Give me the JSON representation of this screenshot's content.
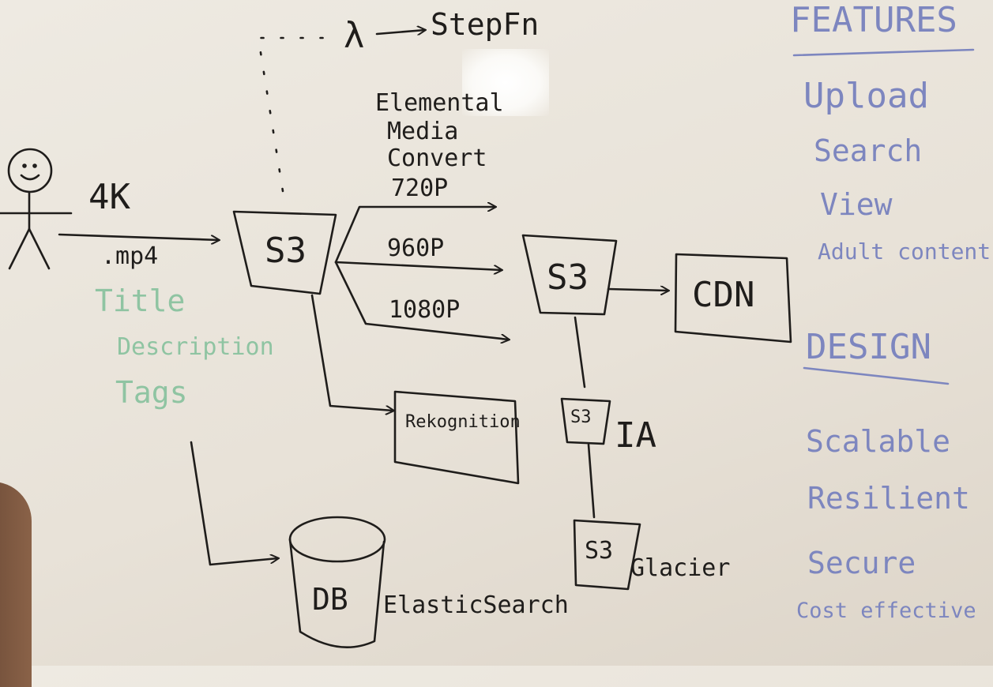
{
  "actor": {
    "upload_label": "4K",
    "format_label": ".mp4"
  },
  "metadata_fields": [
    "Title",
    "Description",
    "Tags"
  ],
  "pipeline": {
    "source_bucket": "S3",
    "trigger_symbol": "λ",
    "step_function": "StepFn",
    "converter": [
      "Elemental",
      "Media",
      "Convert"
    ],
    "resolutions": [
      "720P",
      "960P",
      "1080P"
    ],
    "output_bucket": "S3",
    "cdn": "CDN",
    "rekognition": "Rekognition",
    "ia_bucket": "S3",
    "ia_label": "IA",
    "glacier_bucket": "S3",
    "glacier_label": "Glacier",
    "database": "DB",
    "search_engine": "ElasticSearch"
  },
  "features": {
    "heading": "FEATURES",
    "items": [
      "Upload",
      "Search",
      "View",
      "Adult content"
    ]
  },
  "design": {
    "heading": "DESIGN",
    "items": [
      "Scalable",
      "Resilient",
      "Secure",
      "Cost effective"
    ]
  },
  "colors": {
    "ink_black": "#1f1d1b",
    "ink_green": "#8fc4a2",
    "ink_blue": "#7d86bf",
    "board": "#e9e4db"
  }
}
